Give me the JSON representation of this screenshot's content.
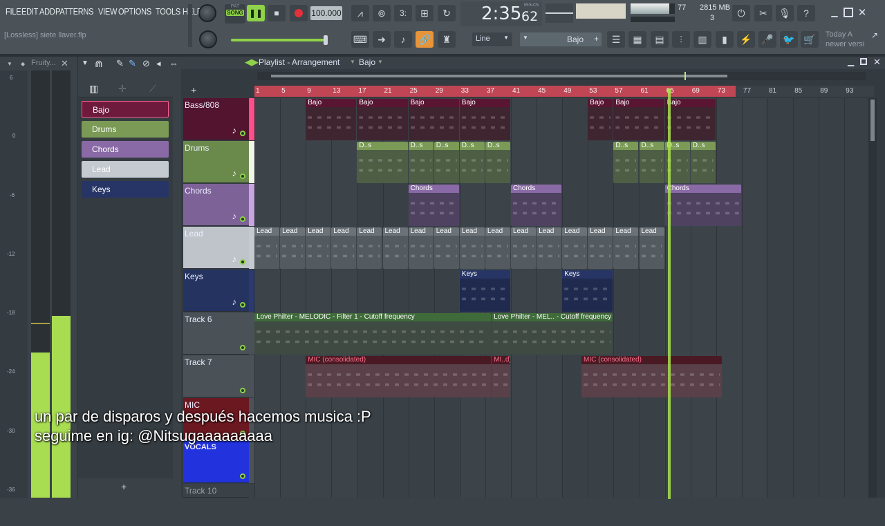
{
  "menu": [
    "FILE",
    "EDIT",
    "ADD",
    "PATTERNS",
    "VIEW",
    "OPTIONS",
    "TOOLS",
    "HELP"
  ],
  "transport": {
    "mode_top": "PAT",
    "mode_label": "SONG",
    "tempo": "100.000",
    "time": "2:35",
    "time_small": "62",
    "time_unit": "M:S:CS"
  },
  "cpu": {
    "value": "77",
    "memory": "2815 MB",
    "voices": "3"
  },
  "hint": {
    "line1": "Today  A",
    "line2": "newer versi"
  },
  "file": {
    "name": "[Lossless] siete llaver.flp"
  },
  "toolbar2": {
    "snap": "Line",
    "pattern": "Bajo"
  },
  "channel_panel": {
    "title": "Fruity..."
  },
  "playlist": {
    "title": "Playlist - Arrangement",
    "pattern": "Bajo"
  },
  "ruler": [
    "1",
    "5",
    "9",
    "13",
    "17",
    "21",
    "25",
    "29",
    "33",
    "37",
    "41",
    "45",
    "49",
    "53",
    "57",
    "61",
    "65",
    "69",
    "73",
    "77",
    "81",
    "85",
    "89",
    "93"
  ],
  "picker": [
    {
      "label": "Bajo",
      "color": "#6d1a3c"
    },
    {
      "label": "Drums",
      "color": "#7a9a55"
    },
    {
      "label": "Chords",
      "color": "#8a6aa6"
    },
    {
      "label": "Lead",
      "color": "#c5cad0"
    },
    {
      "label": "Keys",
      "color": "#273566"
    }
  ],
  "tracks": [
    {
      "name": "Bass/808",
      "color": "#52142e"
    },
    {
      "name": "Drums",
      "color": "#6a8a4c"
    },
    {
      "name": "Chords",
      "color": "#7d6298"
    },
    {
      "name": "Lead",
      "color": "#bfc4ca"
    },
    {
      "name": "Keys",
      "color": "#243360"
    },
    {
      "name": "Track 6",
      "color": "#4a5258"
    },
    {
      "name": "Track 7",
      "color": "#4a5258"
    },
    {
      "name": "MIC",
      "color": "#6b1820"
    },
    {
      "name": "VOCALS",
      "color": "#2233dd"
    },
    {
      "name": "Track 10",
      "color": "#3a4147"
    }
  ],
  "clips": {
    "bajo": "Bajo",
    "drums": "D..s",
    "chords": "Chords",
    "lead": "Lead",
    "keys": "Keys",
    "auto1": "Love Philter - MELODIC - Filter 1 - Cutoff frequency",
    "auto2": "Love Philter - MEL.. - Cutoff frequency",
    "mic1": "MIC (consolidated)",
    "mic2": "MI..d)",
    "mic3": "MIC (consolidated)"
  },
  "meter_labels": [
    "6",
    "0",
    "-6",
    "-12",
    "-18",
    "-24",
    "-30",
    "-36"
  ],
  "subtitle": {
    "line1": "un par de disparos y después hacemos musica :P",
    "line2": "seguime en ig: @Nitsugaaaaaaaaa"
  }
}
